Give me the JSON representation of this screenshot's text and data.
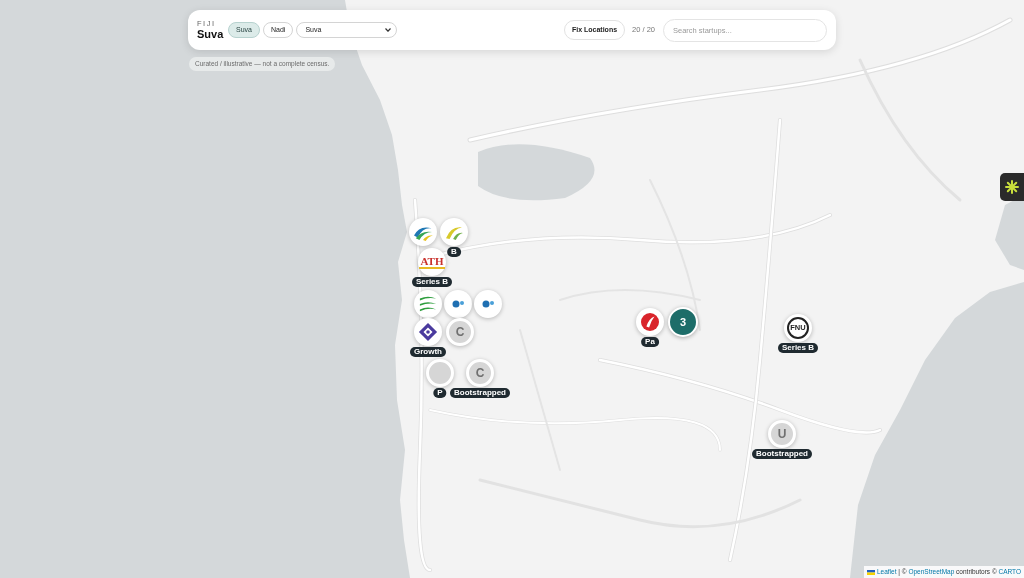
{
  "header": {
    "country": "FIJI",
    "city": "Suva",
    "tabs": [
      {
        "label": "Suva",
        "selected": true
      },
      {
        "label": "Nadi",
        "selected": false
      }
    ],
    "city_select": {
      "value": "Suva"
    },
    "fix_button": "Fix Locations",
    "count": "20 / 20",
    "search": {
      "placeholder": "Search startups..."
    }
  },
  "note": "Curated / illustrative — not a complete census.",
  "markers": [
    {
      "kind": "swoosh"
    },
    {
      "kind": "arc",
      "label": "B"
    },
    {
      "kind": "wordmark",
      "text": "ATH",
      "label": "Series B"
    },
    {
      "kind": "dots"
    },
    {
      "kind": "stripes"
    },
    {
      "kind": "dots"
    },
    {
      "kind": "initial",
      "text": "C"
    },
    {
      "kind": "diamond",
      "label": "Growth"
    },
    {
      "kind": "blank",
      "label": "P"
    },
    {
      "kind": "initial",
      "text": "C",
      "label": "Bootstrapped"
    },
    {
      "kind": "red",
      "label": "Pa"
    },
    {
      "kind": "seal",
      "text": "FNU",
      "label": "Series B"
    },
    {
      "kind": "initial",
      "text": "U",
      "label": "Bootstrapped"
    }
  ],
  "cluster": {
    "count": "3"
  },
  "attribution": [
    {
      "kind": "link",
      "text": "Leaflet"
    },
    {
      "kind": "text",
      "text": "| ©"
    },
    {
      "kind": "link",
      "text": "OpenStreetMap"
    },
    {
      "kind": "text",
      "text": "contributors ©"
    },
    {
      "kind": "link",
      "text": "CARTO"
    }
  ]
}
